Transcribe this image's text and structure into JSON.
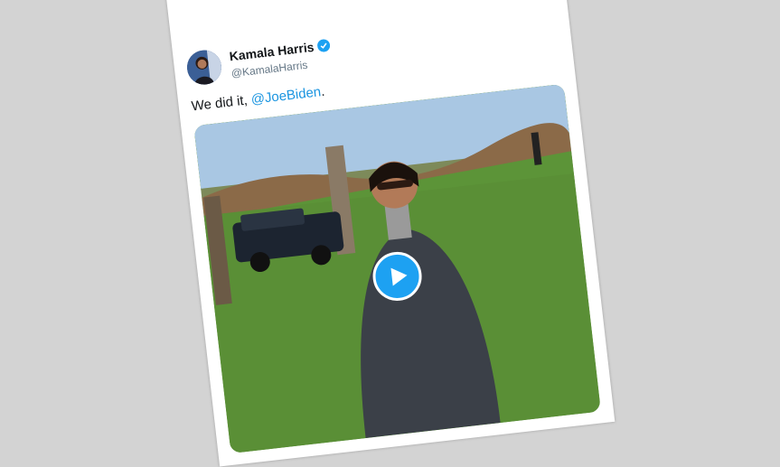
{
  "tweet": {
    "author_name": "Kamala Harris",
    "author_handle": "@KamalaHarris",
    "text_prefix": "We did it, ",
    "mention": "@JoeBiden",
    "text_suffix": "."
  },
  "icons": {
    "logo": "twitter-bird-icon",
    "verified": "verified-badge-icon",
    "play": "play-icon"
  },
  "colors": {
    "accent": "#1da1f2",
    "mention": "#1b95e0"
  }
}
